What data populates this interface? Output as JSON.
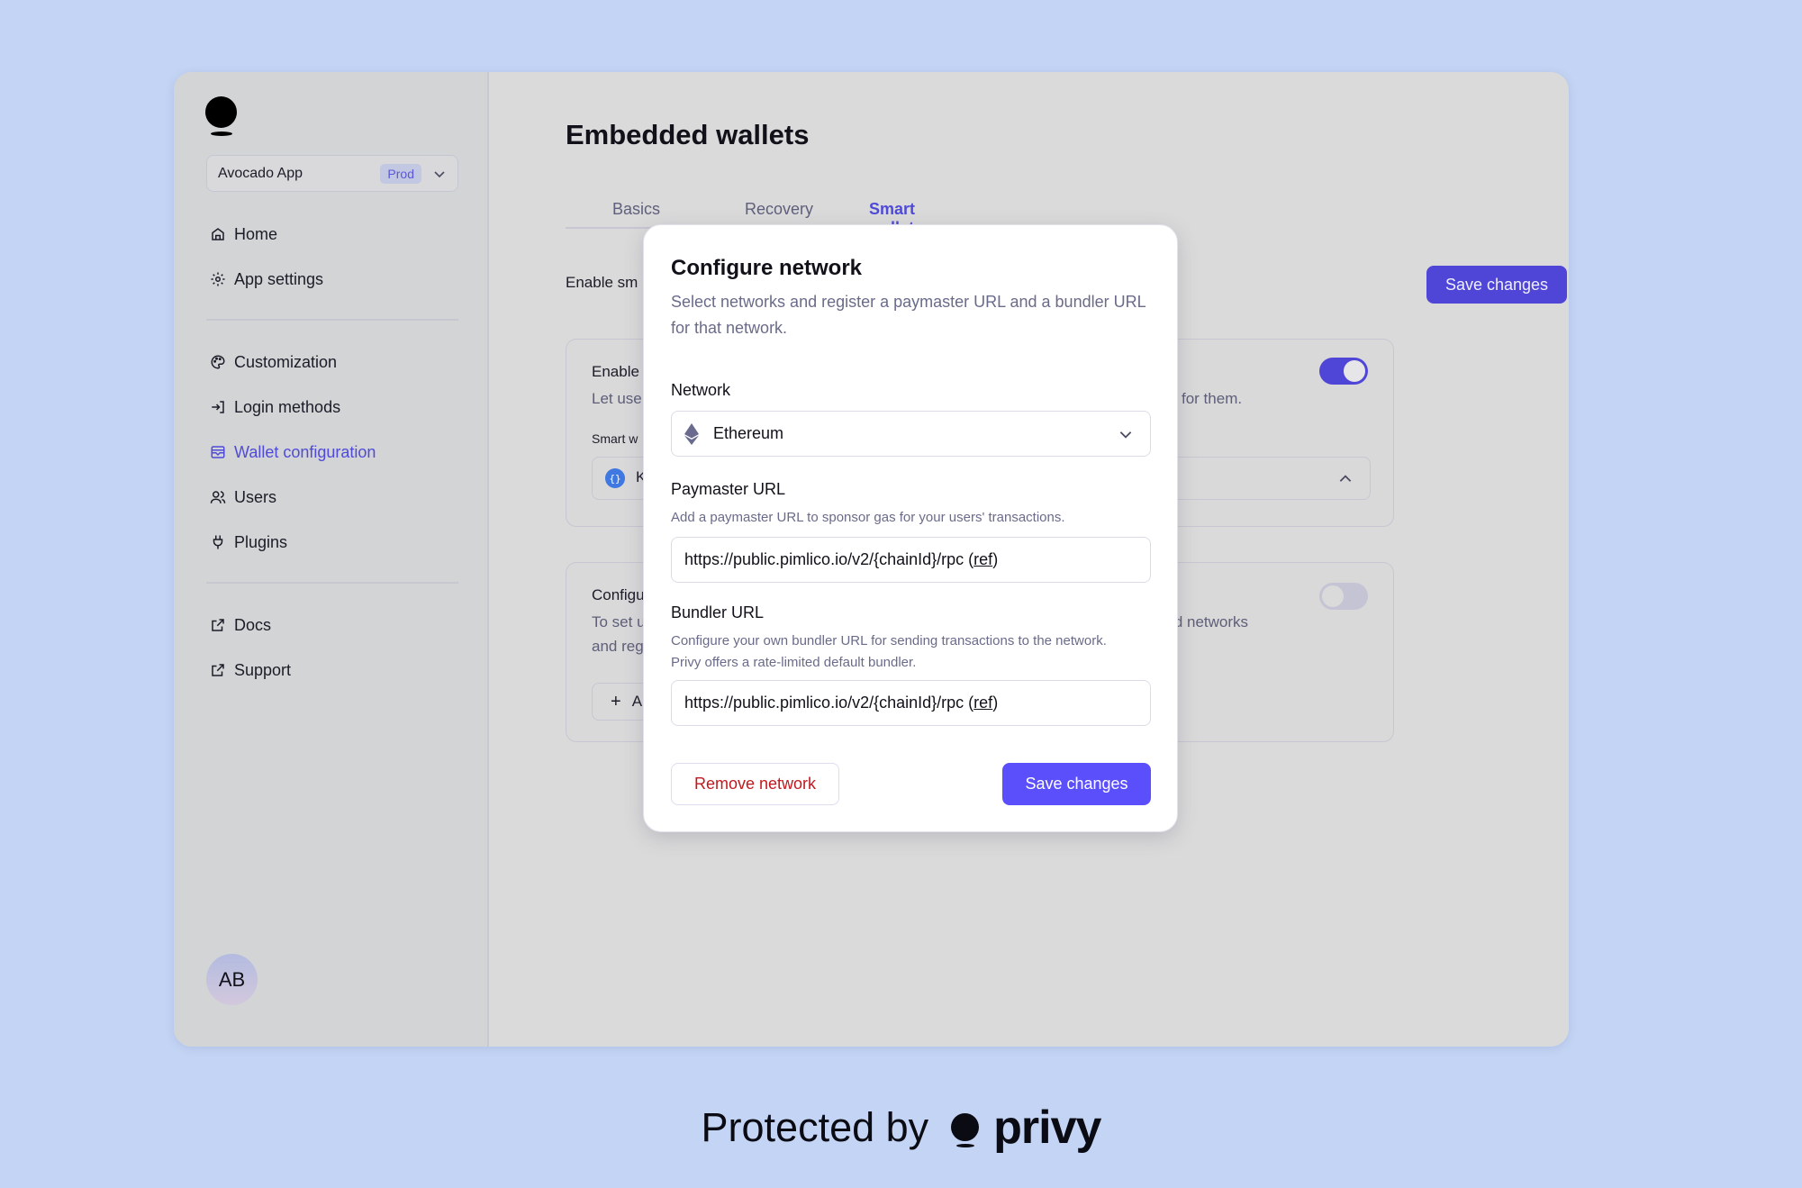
{
  "app": {
    "name": "Avocado App",
    "environment_badge": "Prod"
  },
  "sidebar": {
    "items_top": [
      {
        "label": "Home",
        "icon": "home-icon"
      },
      {
        "label": "App settings",
        "icon": "gear-icon"
      }
    ],
    "items_main": [
      {
        "label": "Customization",
        "icon": "palette-icon"
      },
      {
        "label": "Login methods",
        "icon": "login-icon"
      },
      {
        "label": "Wallet configuration",
        "icon": "wallet-icon",
        "active": true
      },
      {
        "label": "Users",
        "icon": "users-icon"
      },
      {
        "label": "Plugins",
        "icon": "plug-icon"
      }
    ],
    "items_bottom": [
      {
        "label": "Docs",
        "icon": "external-link-icon"
      },
      {
        "label": "Support",
        "icon": "external-link-icon"
      }
    ],
    "avatar_initials": "AB"
  },
  "main": {
    "title": "Embedded wallets",
    "tabs": [
      {
        "label": "Basics"
      },
      {
        "label": "Recovery"
      },
      {
        "label": "Smart wallets",
        "active": true
      }
    ],
    "enable_row_label_visible": "Enable sm",
    "save_label": "Save changes",
    "card1": {
      "title_visible": "Enable",
      "desc_left_visible": "Let use",
      "desc_right_visible": "for them.",
      "select_label_visible": "Smart w",
      "select_value_visible": "K",
      "toggle_on": true
    },
    "card2": {
      "title_visible": "Configu",
      "desc_line1_left": "To set u",
      "desc_line1_right": "rted networks",
      "desc_line2_left": "and reg",
      "add_button_visible": "A",
      "toggle_on": false
    }
  },
  "modal": {
    "title": "Configure network",
    "description": "Select networks and register a paymaster URL and a bundler URL for that network.",
    "network": {
      "label": "Network",
      "value": "Ethereum"
    },
    "paymaster": {
      "label": "Paymaster URL",
      "help": "Add a paymaster URL to sponsor gas for your users' transactions.",
      "value": "https://public.pimlico.io/v2/{chainId}/rpc (",
      "ref": "ref",
      "close": ")"
    },
    "bundler": {
      "label": "Bundler URL",
      "help": "Configure your own bundler URL for sending transactions to the network. Privy offers a rate-limited default bundler.",
      "value": "https://public.pimlico.io/v2/{chainId}/rpc (",
      "ref": "ref",
      "close": ")"
    },
    "remove_label": "Remove network",
    "save_label": "Save changes"
  },
  "footer": {
    "text": "Protected by",
    "brand": "privy"
  },
  "colors": {
    "accent": "#4f46d8",
    "modal_primary": "#5b4ffc",
    "danger": "#c0191f",
    "page_bg": "#c4d4f4"
  }
}
